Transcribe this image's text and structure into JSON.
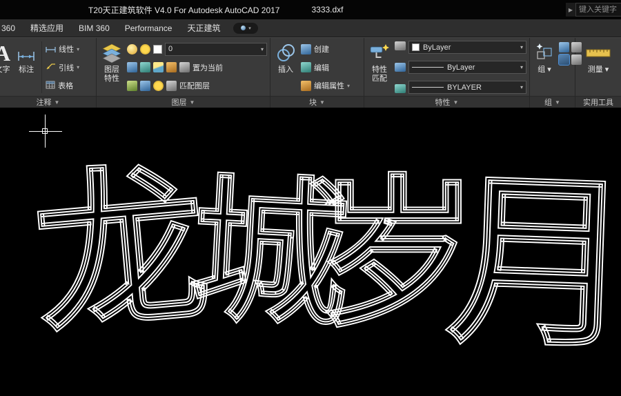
{
  "icons": {
    "panel_arrow": "▼",
    "dropdown_arrow": "▾",
    "play": "▶"
  },
  "title_bar": {
    "app_title": "T20天正建筑软件 V4.0 For Autodesk AutoCAD 2017",
    "file_name": "3333.dxf",
    "search_placeholder": "键入关键字"
  },
  "menubar": {
    "items": [
      "360",
      "精选应用",
      "BIM 360",
      "Performance",
      "天正建筑"
    ]
  },
  "ribbon": {
    "annotate": {
      "text_label": "文字",
      "dim_label": "标注",
      "linear_label": "线性",
      "leader_label": "引线",
      "table_label": "表格",
      "panel": "注释"
    },
    "layers": {
      "layer_props_line1": "图层",
      "layer_props_line2": "特性",
      "current_layer": "0",
      "set_current_label": "置为当前",
      "match_layer_label": "匹配图层",
      "panel": "图层"
    },
    "block": {
      "insert_label": "插入",
      "create_label": "创建",
      "edit_label": "编辑",
      "edit_attr_label": "编辑属性",
      "panel": "块"
    },
    "properties": {
      "match_line1": "特性",
      "match_line2": "匹配",
      "color_value": "ByLayer",
      "linetype_value": "ByLayer",
      "lineweight_value": "BYLAYER",
      "panel": "特性"
    },
    "group": {
      "label": "组",
      "panel": "组"
    },
    "utilities": {
      "measure_label": "测量",
      "panel": "实用工具"
    }
  },
  "canvas": {
    "characters": [
      "龙",
      "城",
      "岁",
      "月"
    ]
  }
}
